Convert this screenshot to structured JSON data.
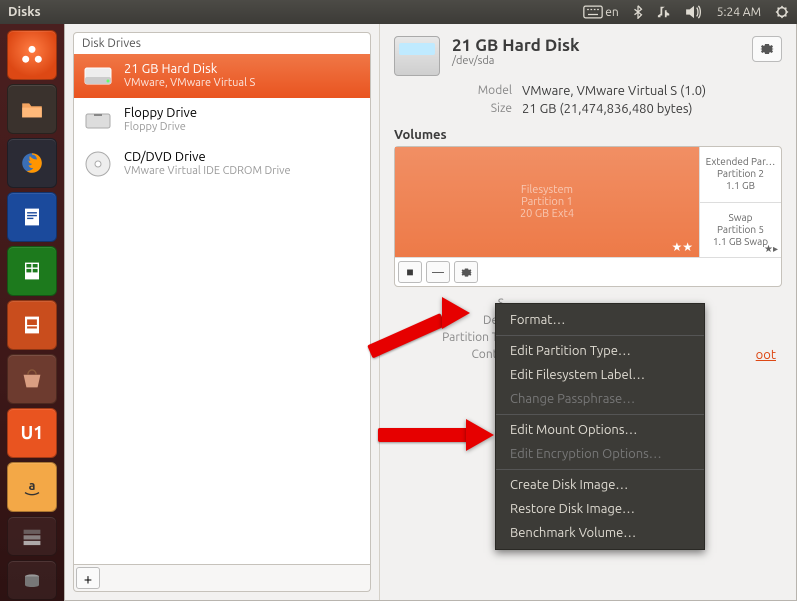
{
  "menubar": {
    "title": "Disks",
    "lang": "en",
    "time": "5:24 AM"
  },
  "drives": {
    "header": "Disk Drives",
    "items": [
      {
        "title": "21 GB Hard Disk",
        "sub": "VMware, VMware Virtual S",
        "icon": "hdd"
      },
      {
        "title": "Floppy Drive",
        "sub": "Floppy Drive",
        "icon": "floppy"
      },
      {
        "title": "CD/DVD Drive",
        "sub": "VMware Virtual IDE CDROM Drive",
        "icon": "cd"
      }
    ]
  },
  "disk": {
    "title": "21 GB Hard Disk",
    "path": "/dev/sda",
    "model_label": "Model",
    "model": "VMware, VMware Virtual S (1.0)",
    "size_label": "Size",
    "size": "21 GB (21,474,836,480 bytes)"
  },
  "volumes": {
    "heading": "Volumes",
    "main": {
      "name": "Filesystem",
      "sub": "Partition 1",
      "size": "20 GB Ext4"
    },
    "ext": {
      "label": "Extended Par…",
      "sub": "Partition 2",
      "size": "1.1 GB"
    },
    "swap": {
      "label": "Swap",
      "sub": "Partition 5",
      "size": "1.1 GB Swap"
    }
  },
  "details": {
    "size_label": "S",
    "device_label": "Dev",
    "ptype_label": "Partition Ty",
    "contents_label": "Conte",
    "mounted_frag": "oot"
  },
  "menu": {
    "format": "Format…",
    "edit_ptype": "Edit Partition Type…",
    "edit_fslabel": "Edit Filesystem Label…",
    "change_pass": "Change Passphrase…",
    "edit_mount": "Edit Mount Options…",
    "edit_enc": "Edit Encryption Options…",
    "create_img": "Create Disk Image…",
    "restore_img": "Restore Disk Image…",
    "benchmark": "Benchmark Volume…"
  }
}
